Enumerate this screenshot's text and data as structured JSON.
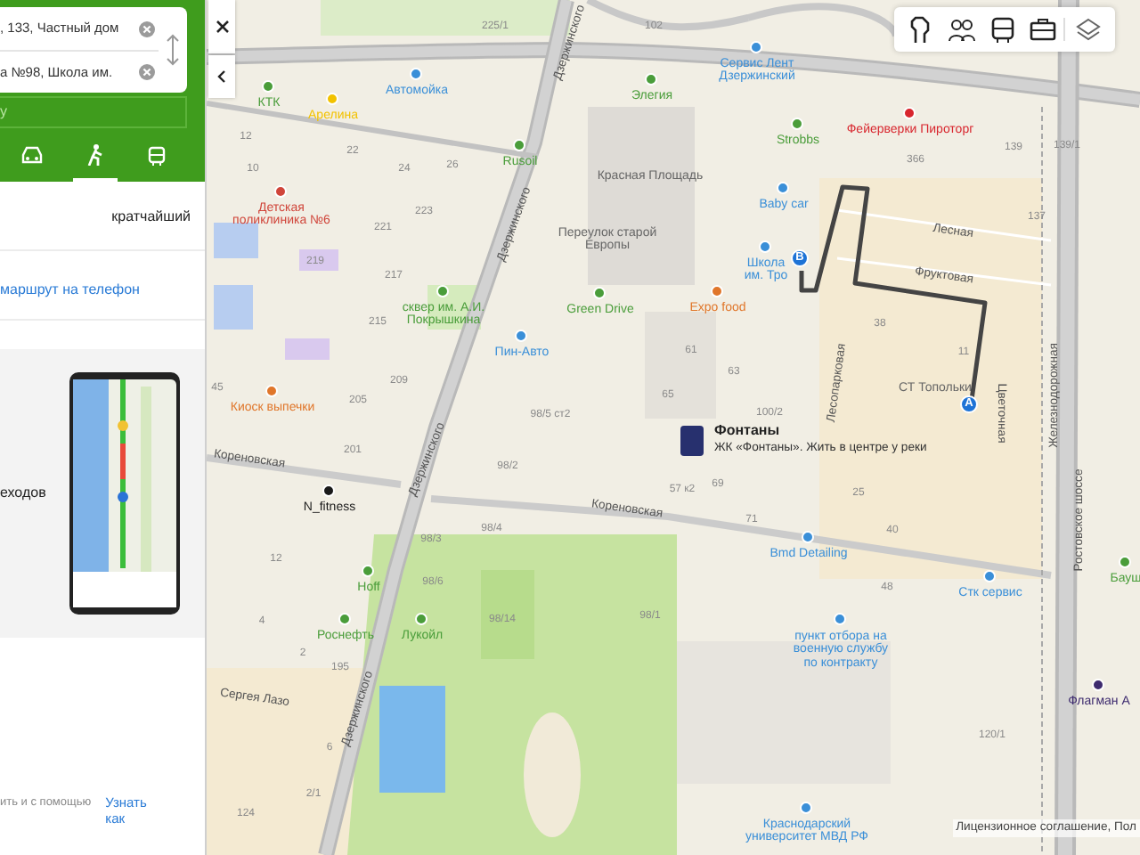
{
  "route_panel": {
    "from_field": {
      "value": ", 133, Частный дом"
    },
    "to_field": {
      "value": "а №98, Школа им."
    },
    "strip_text": "у",
    "modes": [
      {
        "kind": "car",
        "selected": false
      },
      {
        "kind": "walk",
        "selected": true
      },
      {
        "kind": "bus",
        "selected": false
      }
    ],
    "route_option": "кратчайший",
    "send_link": "маршрут на телефон",
    "promo": {
      "text": "еходов"
    },
    "footer": {
      "text": "ить и с помощью",
      "link": "Узнать как"
    }
  },
  "map": {
    "labels": [
      {
        "kind": "street",
        "text": "Дзержинского"
      },
      {
        "kind": "street",
        "text": "Дзержинского"
      },
      {
        "kind": "street",
        "text": "Дзержинского"
      },
      {
        "kind": "street",
        "text": "Дзержинского"
      },
      {
        "kind": "street",
        "text": "Кореновская"
      },
      {
        "kind": "street",
        "text": "Кореновская"
      },
      {
        "kind": "street",
        "text": "Лесная"
      },
      {
        "kind": "street",
        "text": "Фруктовая"
      },
      {
        "kind": "street",
        "text": "Лесопарковая"
      },
      {
        "kind": "street",
        "text": "Цветочная"
      },
      {
        "kind": "street",
        "text": "Железнодорожная"
      },
      {
        "kind": "street",
        "text": "Ростовское шоссе"
      },
      {
        "kind": "street",
        "text": "Сергея Лазо"
      },
      {
        "kind": "place",
        "text": "СТ Топольки"
      },
      {
        "kind": "place",
        "text": "Переулок старой Европы"
      },
      {
        "kind": "place",
        "text": "Красная Площадь"
      },
      {
        "kind": "house",
        "text": "225/1"
      },
      {
        "kind": "house",
        "text": "102"
      },
      {
        "kind": "house",
        "text": "12"
      },
      {
        "kind": "house",
        "text": "22"
      },
      {
        "kind": "house",
        "text": "10"
      },
      {
        "kind": "house",
        "text": "24"
      },
      {
        "kind": "house",
        "text": "26"
      },
      {
        "kind": "house",
        "text": "223"
      },
      {
        "kind": "house",
        "text": "221"
      },
      {
        "kind": "house",
        "text": "219"
      },
      {
        "kind": "house",
        "text": "217"
      },
      {
        "kind": "house",
        "text": "215"
      },
      {
        "kind": "house",
        "text": "209"
      },
      {
        "kind": "house",
        "text": "205"
      },
      {
        "kind": "house",
        "text": "45"
      },
      {
        "kind": "house",
        "text": "98/5 ст2"
      },
      {
        "kind": "house",
        "text": "201"
      },
      {
        "kind": "house",
        "text": "98/2"
      },
      {
        "kind": "house",
        "text": "98/4"
      },
      {
        "kind": "house",
        "text": "98/3"
      },
      {
        "kind": "house",
        "text": "98/6"
      },
      {
        "kind": "house",
        "text": "98/14"
      },
      {
        "kind": "house",
        "text": "98/1"
      },
      {
        "kind": "house",
        "text": "12"
      },
      {
        "kind": "house",
        "text": "4"
      },
      {
        "kind": "house",
        "text": "2"
      },
      {
        "kind": "house",
        "text": "195"
      },
      {
        "kind": "house",
        "text": "6"
      },
      {
        "kind": "house",
        "text": "2/1"
      },
      {
        "kind": "house",
        "text": "124"
      },
      {
        "kind": "house",
        "text": "139"
      },
      {
        "kind": "house",
        "text": "139/1"
      },
      {
        "kind": "house",
        "text": "366"
      },
      {
        "kind": "house",
        "text": "137"
      },
      {
        "kind": "house",
        "text": "38"
      },
      {
        "kind": "house",
        "text": "61"
      },
      {
        "kind": "house",
        "text": "11"
      },
      {
        "kind": "house",
        "text": "63"
      },
      {
        "kind": "house",
        "text": "65"
      },
      {
        "kind": "house",
        "text": "100/2"
      },
      {
        "kind": "house",
        "text": "57 к2"
      },
      {
        "kind": "house",
        "text": "69"
      },
      {
        "kind": "house",
        "text": "25"
      },
      {
        "kind": "house",
        "text": "71"
      },
      {
        "kind": "house",
        "text": "40"
      },
      {
        "kind": "house",
        "text": "48"
      },
      {
        "kind": "house",
        "text": "120/1"
      },
      {
        "kind": "poi",
        "text": "КТК",
        "color": "#4a9d3a"
      },
      {
        "kind": "poi",
        "text": "Арелина",
        "color": "#f2c200"
      },
      {
        "kind": "poi",
        "text": "Автомойка",
        "color": "#3a8fd8"
      },
      {
        "kind": "poi",
        "text": "Rusoil",
        "color": "#4a9d3a"
      },
      {
        "kind": "poi",
        "text": "Детская поликлиника №6",
        "color": "#d0453a"
      },
      {
        "kind": "poi",
        "text": "сквер им. А.И. Покрышкина",
        "color": "#4a9d3a"
      },
      {
        "kind": "poi",
        "text": "Киоск выпечки",
        "color": "#e0762a"
      },
      {
        "kind": "poi",
        "text": "Пин-Авто",
        "color": "#3a8fd8"
      },
      {
        "kind": "poi",
        "text": "Green Drive",
        "color": "#4a9d3a"
      },
      {
        "kind": "poi",
        "text": "Элегия",
        "color": "#4a9d3a"
      },
      {
        "kind": "poi",
        "text": "Сервис Лент Дзержинский",
        "color": "#3a8fd8"
      },
      {
        "kind": "poi",
        "text": "Strobbs",
        "color": "#4a9d3a"
      },
      {
        "kind": "poi",
        "text": "Фейерверки Пироторг",
        "color": "#d8262e"
      },
      {
        "kind": "poi",
        "text": "Baby car",
        "color": "#3a8fd8"
      },
      {
        "kind": "poi",
        "text": "Школа им. Тро",
        "color": "#3a8fd8"
      },
      {
        "kind": "poi",
        "text": "Expo food",
        "color": "#e0762a"
      },
      {
        "kind": "poi",
        "text": "N_fitness",
        "color": "#1a1a1a"
      },
      {
        "kind": "poi",
        "text": "Hoff",
        "color": "#4a9d3a"
      },
      {
        "kind": "poi",
        "text": "Роснефть",
        "color": "#4a9d3a"
      },
      {
        "kind": "poi",
        "text": "Лукойл",
        "color": "#4a9d3a"
      },
      {
        "kind": "poi",
        "text": "Bmd Detailing",
        "color": "#3a8fd8"
      },
      {
        "kind": "poi",
        "text": "Стк сервис",
        "color": "#3a8fd8"
      },
      {
        "kind": "poi",
        "text": "пункт отбора на военную службу по контракту",
        "color": "#3a8fd8"
      },
      {
        "kind": "poi",
        "text": "Флагман А",
        "color": "#3d2a6e"
      },
      {
        "kind": "poi",
        "text": "Краснодарский университет МВД РФ",
        "color": "#3a8fd8"
      },
      {
        "kind": "poi",
        "text": "Бауш",
        "color": "#4a9d3a"
      }
    ],
    "route": {
      "start_marker": "A",
      "end_marker": "B"
    },
    "info_card": {
      "title": "Фонтаны",
      "subtitle": "ЖК «Фонтаны». Жить в центре у реки"
    },
    "attribution": "Лицензионное соглашение, Пол"
  }
}
